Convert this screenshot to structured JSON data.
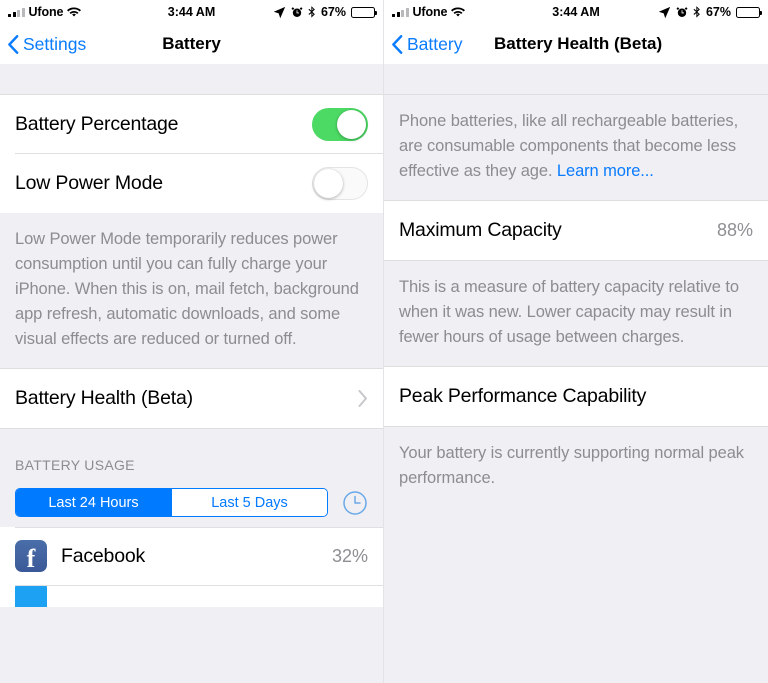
{
  "status_bar": {
    "carrier": "Ufone",
    "time": "3:44 AM",
    "battery_percent": "67%",
    "icons": [
      "signal-bars-icon",
      "wifi-icon",
      "location-arrow-icon",
      "alarm-clock-icon",
      "bluetooth-icon",
      "battery-icon"
    ]
  },
  "colors": {
    "accent_blue": "#007AFF",
    "link_blue": "#0A7CFF",
    "toggle_green": "#4CD964",
    "group_bg": "#F0EFF4",
    "secondary_text": "#8C8C91",
    "facebook_blue": "#3B5998"
  },
  "left_screen": {
    "nav": {
      "back_label": "Settings",
      "title": "Battery"
    },
    "settings": [
      {
        "label": "Battery Percentage",
        "toggle": "on"
      },
      {
        "label": "Low Power Mode",
        "toggle": "off"
      }
    ],
    "low_power_footnote": "Low Power Mode temporarily reduces power consumption until you can fully charge your iPhone. When this is on, mail fetch, background app refresh, automatic downloads, and some visual effects are reduced or turned off.",
    "battery_health_row": {
      "label": "Battery Health (Beta)"
    },
    "usage_header": "BATTERY USAGE",
    "segmented": {
      "options": [
        "Last 24 Hours",
        "Last 5 Days"
      ],
      "selected_index": 0,
      "time_toggle_icon": "clock-icon"
    },
    "apps": [
      {
        "name": "Facebook",
        "percent": "32%",
        "icon": "facebook-icon"
      },
      {
        "name": "",
        "percent": "",
        "icon": "app-icon"
      }
    ]
  },
  "right_screen": {
    "nav": {
      "back_label": "Battery",
      "title": "Battery Health (Beta)"
    },
    "intro": {
      "text": "Phone batteries, like all rechargeable batteries, are consumable components that become less effective as they age.",
      "link": "Learn more..."
    },
    "maximum_capacity": {
      "label": "Maximum Capacity",
      "value": "88%"
    },
    "maximum_capacity_footnote": "This is a measure of battery capacity relative to when it was new. Lower capacity may result in fewer hours of usage between charges.",
    "peak_performance": {
      "label": "Peak Performance Capability"
    },
    "peak_performance_footnote": "Your battery is currently supporting normal peak performance."
  }
}
